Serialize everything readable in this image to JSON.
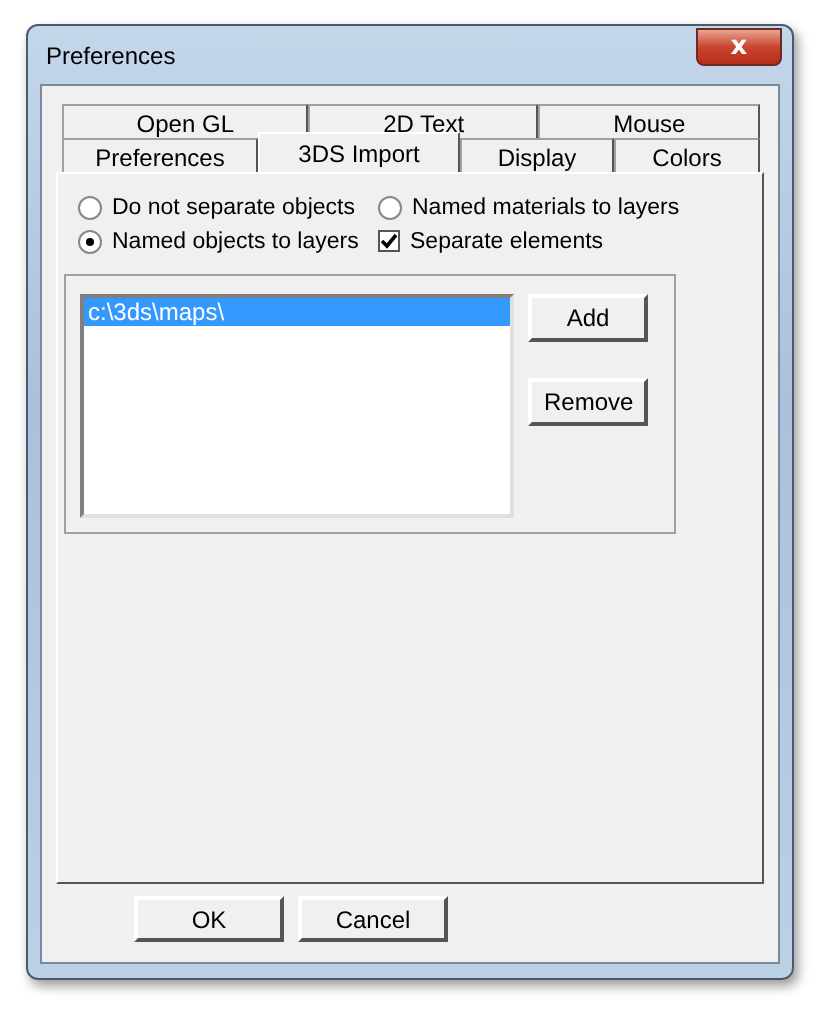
{
  "window": {
    "title": "Preferences",
    "close": "x"
  },
  "tab_rows": [
    [
      {
        "label": "Open GL",
        "selected": false
      },
      {
        "label": "2D Text",
        "selected": false
      },
      {
        "label": "Mouse",
        "selected": false
      }
    ],
    [
      {
        "label": "Preferences",
        "selected": false
      },
      {
        "label": "3DS Import",
        "selected": true
      },
      {
        "label": "Display",
        "selected": false
      },
      {
        "label": "Colors",
        "selected": false
      }
    ]
  ],
  "options": [
    {
      "kind": "radio",
      "label": "Do not separate objects",
      "selected": false
    },
    {
      "kind": "radio",
      "label": "Named materials to layers",
      "selected": false
    },
    {
      "kind": "radio",
      "label": "Named objects to layers",
      "selected": true
    },
    {
      "kind": "checkbox",
      "label": "Separate elements",
      "checked": true
    }
  ],
  "paths": [
    {
      "text": "c:\\3ds\\maps\\",
      "selected": true
    }
  ],
  "side_buttons": [
    "Add",
    "Remove"
  ],
  "buttons": [
    "OK",
    "Cancel"
  ]
}
